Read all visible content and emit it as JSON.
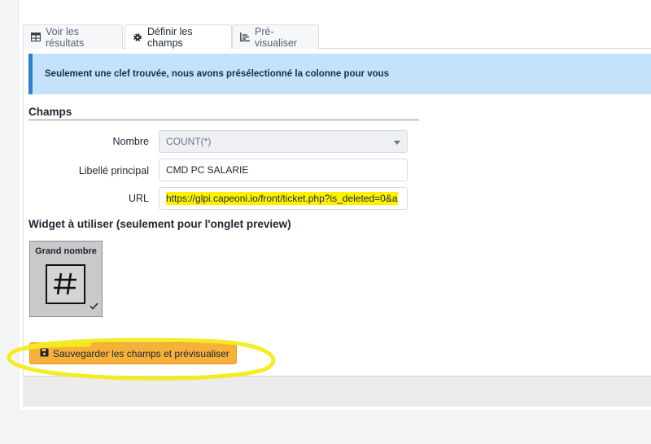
{
  "tabs": [
    {
      "label": "Voir les résultats",
      "icon": "table-icon",
      "active": false
    },
    {
      "label": "Définir les champs",
      "icon": "gear-icon",
      "active": true
    },
    {
      "label": "Pré-visualiser",
      "icon": "chart-icon",
      "active": false
    }
  ],
  "alert": {
    "text": "Seulement une clef trouvée, nous avons présélectionné la colonne pour vous"
  },
  "fields_section": {
    "title": "Champs",
    "nombre": {
      "label": "Nombre",
      "value": "COUNT(*)"
    },
    "libelle": {
      "label": "Libellé principal",
      "value": "CMD PC SALARIE"
    },
    "url": {
      "label": "URL",
      "value": "https://glpi.capeoni.io/front/ticket.php?is_deleted=0&a"
    }
  },
  "widget": {
    "title": "Widget à utiliser (seulement pour l'onglet preview)",
    "selected_label": "Grand nombre",
    "symbol": "#",
    "icon": "hash-icon"
  },
  "save_button": {
    "label": "Sauvegarder les champs et prévisualiser",
    "icon": "floppy-disk-icon"
  },
  "colors": {
    "accent": "#f7b13b",
    "alert_bg": "#c4e3fb",
    "alert_border": "#2f82c9",
    "highlight": "#fff200"
  }
}
